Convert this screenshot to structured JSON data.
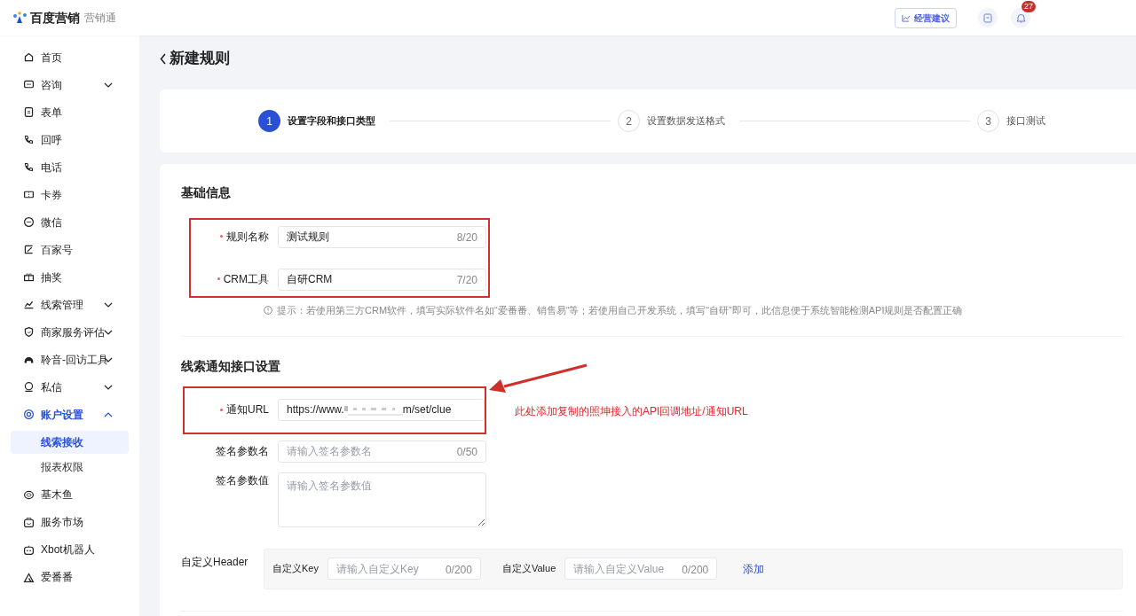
{
  "header": {
    "logo": "百度营销",
    "product": "营销通",
    "advice_button": "经营建议",
    "notification_count": "27"
  },
  "sidebar": {
    "items": [
      {
        "label": "首页",
        "selected": false
      },
      {
        "label": "咨询",
        "selected": false,
        "expanded": false
      },
      {
        "label": "表单",
        "selected": false
      },
      {
        "label": "回呼",
        "selected": false
      },
      {
        "label": "电话",
        "selected": false
      },
      {
        "label": "卡券",
        "selected": false
      },
      {
        "label": "微信",
        "selected": false
      },
      {
        "label": "百家号",
        "selected": false
      },
      {
        "label": "抽奖",
        "selected": false
      },
      {
        "label": "线索管理",
        "selected": false,
        "expanded": false
      },
      {
        "label": "商家服务评估",
        "selected": false,
        "expanded": false
      },
      {
        "label": "聆音-回访工具",
        "selected": false,
        "expanded": false
      },
      {
        "label": "私信",
        "selected": false,
        "expanded": false
      },
      {
        "label": "账户设置",
        "selected": true,
        "expanded": true,
        "children": [
          {
            "label": "线索接收",
            "selected": true
          },
          {
            "label": "报表权限",
            "selected": false
          }
        ]
      },
      {
        "label": "基木鱼",
        "selected": false
      },
      {
        "label": "服务市场",
        "selected": false
      },
      {
        "label": "Xbot机器人",
        "selected": false
      },
      {
        "label": "爱番番",
        "selected": false
      }
    ]
  },
  "page_title": "新建规则",
  "steps": [
    {
      "number": "1",
      "label": "设置字段和接口类型",
      "selected": true
    },
    {
      "number": "2",
      "label": "设置数据发送格式",
      "selected": false
    },
    {
      "number": "3",
      "label": "接口测试",
      "selected": false
    }
  ],
  "basic": {
    "title": "基础信息",
    "fields": [
      {
        "label": "规则名称",
        "required": true,
        "value": "测试规则",
        "count": "8/20"
      },
      {
        "label": "CRM工具",
        "required": true,
        "value": "自研CRM",
        "count": "7/20"
      }
    ],
    "hint": "提示：若使用第三方CRM软件，填写实际软件名如“爱番番、销售易”等；若使用自己开发系统，填写“自研”即可，此信息便于系统智能检测API规则是否配置正确"
  },
  "notify": {
    "title": "线索通知接口设置",
    "url": {
      "label": "通知URL",
      "required": true,
      "value_start": "https://www.",
      "value_end": "m/set/clue"
    },
    "sign_name": {
      "label": "签名参数名",
      "required": false,
      "placeholder": "请输入签名参数名",
      "count": "0/50"
    },
    "sign_value": {
      "label": "签名参数值",
      "required": false,
      "placeholder": "请输入签名参数值"
    },
    "custom_header": {
      "label": "自定义Header",
      "key_label": "自定义Key",
      "key_placeholder": "请输入自定义Key",
      "key_count": "0/200",
      "value_label": "自定义Value",
      "value_placeholder": "请输入自定义Value",
      "value_count": "0/200",
      "add_link": "添加"
    }
  },
  "annotation": "此处添加复制的照坤接入的API回调地址/通知URL"
}
